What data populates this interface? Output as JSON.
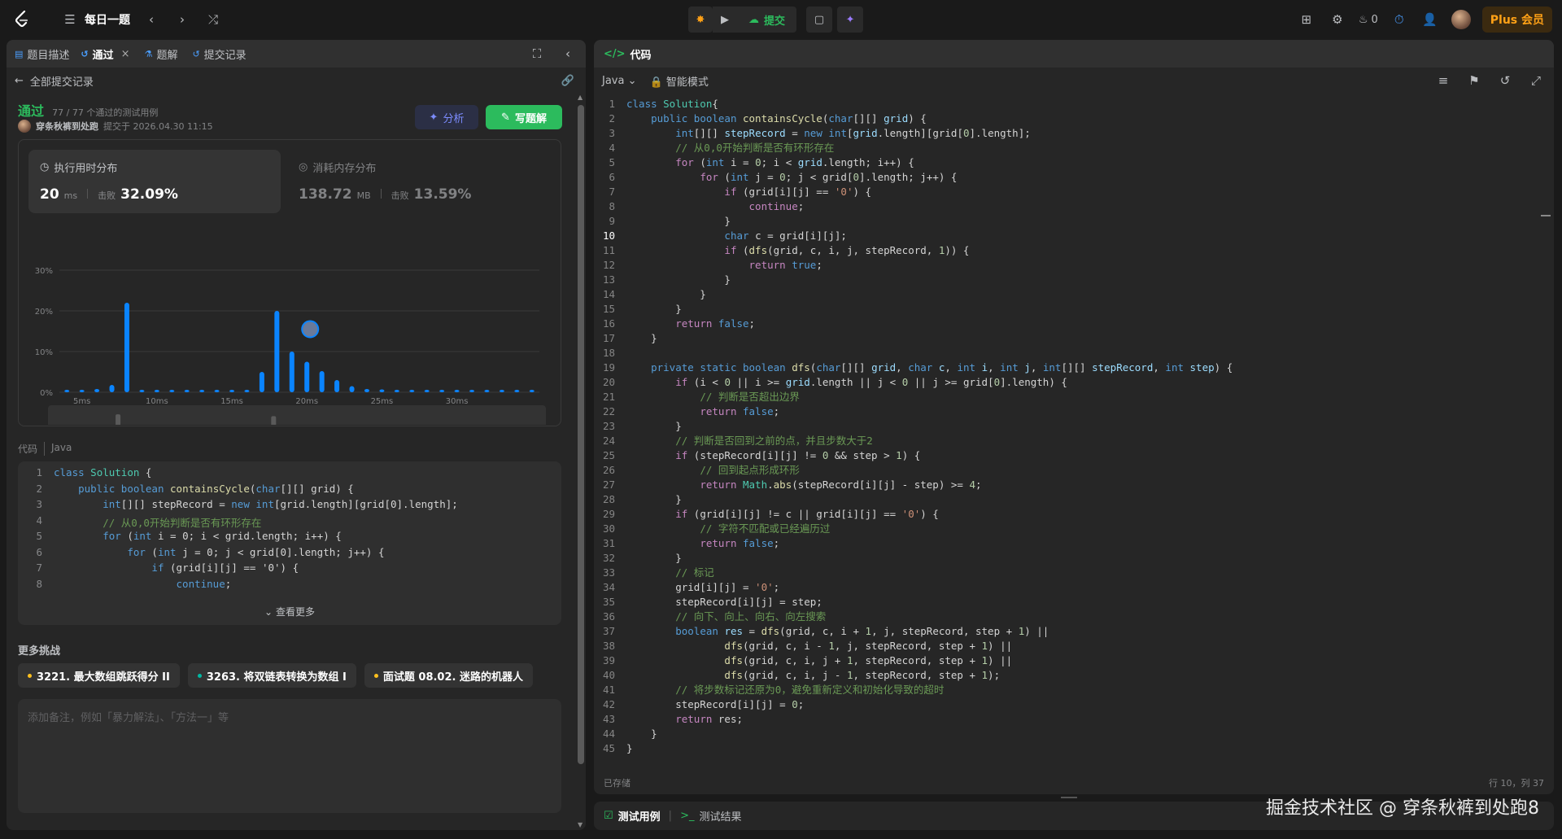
{
  "app": {
    "accent": "#2cbb5d",
    "brand_orange": "#ffa116"
  },
  "topbar": {
    "logo_icon": "leetcode-logo-icon",
    "list_label": "每日一题",
    "submit_label": "提交",
    "fire_count": "0",
    "plus_label": "Plus 会员"
  },
  "left": {
    "tabs": [
      {
        "label": "题目描述",
        "icon": "doc-icon"
      },
      {
        "label": "通过",
        "icon": "history-icon"
      },
      {
        "label": "题解",
        "icon": "flask-icon"
      },
      {
        "label": "提交记录",
        "icon": "history-icon"
      }
    ],
    "back_label": "全部提交记录",
    "status": "通过",
    "cases": "77 / 77 个通过的测试用例",
    "submitter": "穿条秋裤到处跑",
    "submitted_at": "提交于 2026.04.30 11:15",
    "analyze_label": "分析",
    "solution_label": "写题解",
    "runtime": {
      "title": "执行用时分布",
      "value": "20",
      "unit": "ms",
      "beats_label": "击败",
      "beats": "32.09%"
    },
    "memory": {
      "title": "消耗内存分布",
      "value": "138.72",
      "unit": "MB",
      "beats_label": "击败",
      "beats": "13.59%"
    },
    "code_label": "代码",
    "code_lang": "Java",
    "preview_lines": [
      "class Solution {",
      "    public boolean containsCycle(char[][] grid) {",
      "        int[][] stepRecord = new int[grid.length][grid[0].length];",
      "        // 从0,0开始判断是否有环形存在",
      "        for (int i = 0; i < grid.length; i++) {",
      "            for (int j = 0; j < grid[0].length; j++) {",
      "                if (grid[i][j] == '0') {",
      "                    continue;"
    ],
    "see_more": "查看更多",
    "more_challenges": "更多挑战",
    "challenges": [
      {
        "label": "3221. 最大数组跳跃得分 II",
        "color": "#ffc01e"
      },
      {
        "label": "3263. 将双链表转换为数组 I",
        "color": "#00b8a3"
      },
      {
        "label": "面试题 08.02. 迷路的机器人",
        "color": "#ffc01e"
      }
    ],
    "note_placeholder": "添加备注，例如「暴力解法」、「方法一」等"
  },
  "chart_data": {
    "type": "bar",
    "title": "执行用时分布",
    "ylabel_ticks": [
      "0%",
      "10%",
      "20%",
      "30%"
    ],
    "ylim": [
      0,
      30
    ],
    "x_ticks": [
      "5ms",
      "10ms",
      "15ms",
      "20ms",
      "25ms",
      "30ms"
    ],
    "x": [
      4,
      5,
      6,
      7,
      8,
      9,
      10,
      11,
      12,
      13,
      14,
      15,
      16,
      17,
      18,
      19,
      20,
      21,
      22,
      23,
      24,
      25,
      26,
      27,
      28,
      29,
      30,
      31,
      32,
      33,
      34,
      35
    ],
    "values": [
      0.5,
      0.6,
      0.8,
      1.8,
      22,
      0.6,
      0.5,
      0.5,
      0.5,
      0.5,
      0.5,
      0.5,
      0.6,
      5,
      20,
      10,
      7.5,
      5.2,
      3,
      1.5,
      0.8,
      0.7,
      0.6,
      0.6,
      0.6,
      0.5,
      0.5,
      0.5,
      0.5,
      0.5,
      0.5,
      0.5
    ],
    "highlight_x": 20,
    "bar_color": "#0a84ff",
    "grid": true
  },
  "editor": {
    "tab_label": "代码",
    "language": "Java",
    "mode": "智能模式",
    "saved": "已存储",
    "cursor": "行 10，列 37",
    "current_line": 10,
    "lines": [
      [
        [
          "kw",
          "class "
        ],
        [
          "ty",
          "Solution"
        ],
        [
          "",
          "{"
        ]
      ],
      [
        [
          "",
          "    "
        ],
        [
          "kw",
          "public boolean "
        ],
        [
          "fn",
          "containsCycle"
        ],
        [
          "",
          "("
        ],
        [
          "kw",
          "char"
        ],
        [
          "",
          "[][] "
        ],
        [
          "va",
          "grid"
        ],
        [
          "",
          ") {"
        ]
      ],
      [
        [
          "",
          "        "
        ],
        [
          "kw",
          "int"
        ],
        [
          "",
          "[][] "
        ],
        [
          "va",
          "stepRecord"
        ],
        [
          "",
          " = "
        ],
        [
          "kw",
          "new "
        ],
        [
          "kw",
          "int"
        ],
        [
          "",
          "["
        ],
        [
          "va",
          "grid"
        ],
        [
          "",
          ".length][grid["
        ],
        [
          "nu",
          "0"
        ],
        [
          "",
          "].length];"
        ]
      ],
      [
        [
          "",
          "        "
        ],
        [
          "cm",
          "// 从0,0开始判断是否有环形存在"
        ]
      ],
      [
        [
          "",
          "        "
        ],
        [
          "ctrl",
          "for "
        ],
        [
          "",
          "("
        ],
        [
          "kw",
          "int "
        ],
        [
          "",
          "i = "
        ],
        [
          "nu",
          "0"
        ],
        [
          "",
          "; i < "
        ],
        [
          "va",
          "grid"
        ],
        [
          "",
          ".length; i++) {"
        ]
      ],
      [
        [
          "",
          "            "
        ],
        [
          "ctrl",
          "for "
        ],
        [
          "",
          "("
        ],
        [
          "kw",
          "int "
        ],
        [
          "",
          "j = "
        ],
        [
          "nu",
          "0"
        ],
        [
          "",
          "; j < grid["
        ],
        [
          "nu",
          "0"
        ],
        [
          "",
          "].length; j++) {"
        ]
      ],
      [
        [
          "",
          "                "
        ],
        [
          "ctrl",
          "if "
        ],
        [
          "",
          "(grid[i][j] == "
        ],
        [
          "st",
          "'0'"
        ],
        [
          "",
          ") {"
        ]
      ],
      [
        [
          "",
          "                    "
        ],
        [
          "ctrl",
          "continue"
        ],
        [
          "",
          ";"
        ]
      ],
      [
        [
          "",
          "                }"
        ]
      ],
      [
        [
          "",
          "                "
        ],
        [
          "kw",
          "char "
        ],
        [
          "",
          "c = grid[i][j];"
        ]
      ],
      [
        [
          "",
          "                "
        ],
        [
          "ctrl",
          "if "
        ],
        [
          "",
          "("
        ],
        [
          "fn",
          "dfs"
        ],
        [
          "",
          "(grid, c, i, j, stepRecord, "
        ],
        [
          "nu",
          "1"
        ],
        [
          "",
          ")) {"
        ]
      ],
      [
        [
          "",
          "                    "
        ],
        [
          "ctrl",
          "return "
        ],
        [
          "kw",
          "true"
        ],
        [
          "",
          ";"
        ]
      ],
      [
        [
          "",
          "                }"
        ]
      ],
      [
        [
          "",
          "            }"
        ]
      ],
      [
        [
          "",
          "        }"
        ]
      ],
      [
        [
          "",
          "        "
        ],
        [
          "ctrl",
          "return "
        ],
        [
          "kw",
          "false"
        ],
        [
          "",
          ";"
        ]
      ],
      [
        [
          "",
          "    }"
        ]
      ],
      [
        [
          "",
          ""
        ]
      ],
      [
        [
          "",
          "    "
        ],
        [
          "kw",
          "private static boolean "
        ],
        [
          "fn",
          "dfs"
        ],
        [
          "",
          "("
        ],
        [
          "kw",
          "char"
        ],
        [
          "",
          "[][] "
        ],
        [
          "va",
          "grid"
        ],
        [
          "",
          ", "
        ],
        [
          "kw",
          "char "
        ],
        [
          "va",
          "c"
        ],
        [
          "",
          ", "
        ],
        [
          "kw",
          "int "
        ],
        [
          "va",
          "i"
        ],
        [
          "",
          ", "
        ],
        [
          "kw",
          "int "
        ],
        [
          "va",
          "j"
        ],
        [
          "",
          ", "
        ],
        [
          "kw",
          "int"
        ],
        [
          "",
          "[][] "
        ],
        [
          "va",
          "stepRecord"
        ],
        [
          "",
          ", "
        ],
        [
          "kw",
          "int "
        ],
        [
          "va",
          "step"
        ],
        [
          "",
          ") {"
        ]
      ],
      [
        [
          "",
          "        "
        ],
        [
          "ctrl",
          "if "
        ],
        [
          "",
          "(i < "
        ],
        [
          "nu",
          "0"
        ],
        [
          "",
          " || i >= "
        ],
        [
          "va",
          "grid"
        ],
        [
          "",
          ".length || j < "
        ],
        [
          "nu",
          "0"
        ],
        [
          "",
          " || j >= grid["
        ],
        [
          "nu",
          "0"
        ],
        [
          "",
          "].length) {"
        ]
      ],
      [
        [
          "",
          "            "
        ],
        [
          "cm",
          "// 判断是否超出边界"
        ]
      ],
      [
        [
          "",
          "            "
        ],
        [
          "ctrl",
          "return "
        ],
        [
          "kw",
          "false"
        ],
        [
          "",
          ";"
        ]
      ],
      [
        [
          "",
          "        }"
        ]
      ],
      [
        [
          "",
          "        "
        ],
        [
          "cm",
          "// 判断是否回到之前的点，并且步数大于2"
        ]
      ],
      [
        [
          "",
          "        "
        ],
        [
          "ctrl",
          "if "
        ],
        [
          "",
          "(stepRecord[i][j] != "
        ],
        [
          "nu",
          "0"
        ],
        [
          "",
          " && step > "
        ],
        [
          "nu",
          "1"
        ],
        [
          "",
          ") {"
        ]
      ],
      [
        [
          "",
          "            "
        ],
        [
          "cm",
          "// 回到起点形成环形"
        ]
      ],
      [
        [
          "",
          "            "
        ],
        [
          "ctrl",
          "return "
        ],
        [
          "ty",
          "Math"
        ],
        [
          "",
          "."
        ],
        [
          "fn",
          "abs"
        ],
        [
          "",
          "(stepRecord[i][j] - step) >= "
        ],
        [
          "nu",
          "4"
        ],
        [
          "",
          ";"
        ]
      ],
      [
        [
          "",
          "        }"
        ]
      ],
      [
        [
          "",
          "        "
        ],
        [
          "ctrl",
          "if "
        ],
        [
          "",
          "(grid[i][j] != c || grid[i][j] == "
        ],
        [
          "st",
          "'0'"
        ],
        [
          "",
          ") {"
        ]
      ],
      [
        [
          "",
          "            "
        ],
        [
          "cm",
          "// 字符不匹配或已经遍历过"
        ]
      ],
      [
        [
          "",
          "            "
        ],
        [
          "ctrl",
          "return "
        ],
        [
          "kw",
          "false"
        ],
        [
          "",
          ";"
        ]
      ],
      [
        [
          "",
          "        }"
        ]
      ],
      [
        [
          "",
          "        "
        ],
        [
          "cm",
          "// 标记"
        ]
      ],
      [
        [
          "",
          "        grid[i][j] = "
        ],
        [
          "st",
          "'0'"
        ],
        [
          "",
          ";"
        ]
      ],
      [
        [
          "",
          "        stepRecord[i][j] = step;"
        ]
      ],
      [
        [
          "",
          "        "
        ],
        [
          "cm",
          "// 向下、向上、向右、向左搜索"
        ]
      ],
      [
        [
          "",
          "        "
        ],
        [
          "kw",
          "boolean "
        ],
        [
          "va",
          "res"
        ],
        [
          "",
          " = "
        ],
        [
          "fn",
          "dfs"
        ],
        [
          "",
          "(grid, c, i + "
        ],
        [
          "nu",
          "1"
        ],
        [
          "",
          ", j, stepRecord, step + "
        ],
        [
          "nu",
          "1"
        ],
        [
          "",
          ") ||"
        ]
      ],
      [
        [
          "",
          "                "
        ],
        [
          "fn",
          "dfs"
        ],
        [
          "",
          "(grid, c, i - "
        ],
        [
          "nu",
          "1"
        ],
        [
          "",
          ", j, stepRecord, step + "
        ],
        [
          "nu",
          "1"
        ],
        [
          "",
          ") ||"
        ]
      ],
      [
        [
          "",
          "                "
        ],
        [
          "fn",
          "dfs"
        ],
        [
          "",
          "(grid, c, i, j + "
        ],
        [
          "nu",
          "1"
        ],
        [
          "",
          ", stepRecord, step + "
        ],
        [
          "nu",
          "1"
        ],
        [
          "",
          ") ||"
        ]
      ],
      [
        [
          "",
          "                "
        ],
        [
          "fn",
          "dfs"
        ],
        [
          "",
          "(grid, c, i, j - "
        ],
        [
          "nu",
          "1"
        ],
        [
          "",
          ", stepRecord, step + "
        ],
        [
          "nu",
          "1"
        ],
        [
          "",
          ");"
        ]
      ],
      [
        [
          "",
          "        "
        ],
        [
          "cm",
          "// 将步数标记还原为0，避免重新定义和初始化导致的超时"
        ]
      ],
      [
        [
          "",
          "        stepRecord[i][j] = "
        ],
        [
          "nu",
          "0"
        ],
        [
          "",
          ";"
        ]
      ],
      [
        [
          "",
          "        "
        ],
        [
          "ctrl",
          "return "
        ],
        [
          "",
          "res;"
        ]
      ],
      [
        [
          "",
          "    }"
        ]
      ],
      [
        [
          "",
          "}"
        ]
      ]
    ]
  },
  "bottom": {
    "testcase_label": "测试用例",
    "result_label": "测试结果"
  },
  "watermark": "掘金技术社区 @ 穿条秋裤到处跑8"
}
